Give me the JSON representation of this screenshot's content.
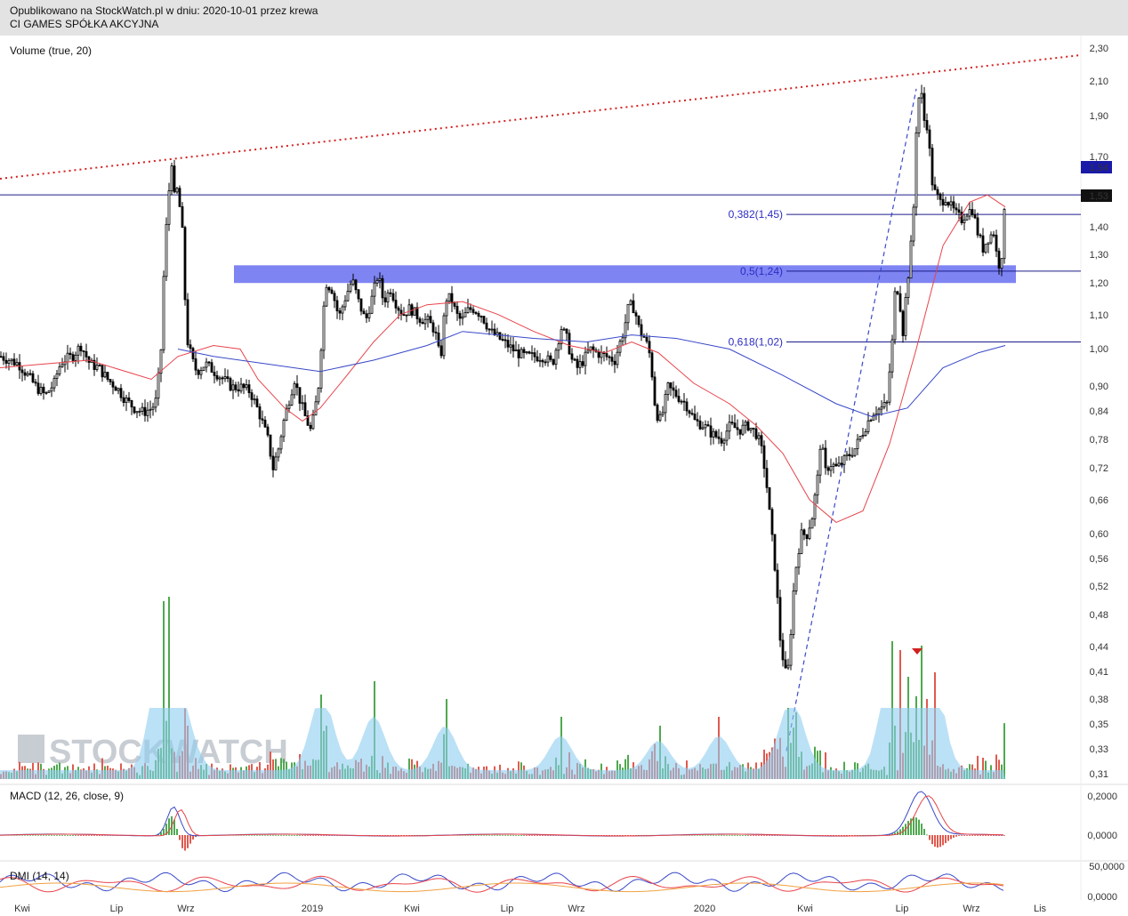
{
  "header": {
    "published": "Opublikowano na StockWatch.pl w dniu: 2020-10-01 przez krewa",
    "instrument": "CI GAMES SPÓŁKA AKCYJNA"
  },
  "watermark": "STOCKWATCH",
  "colors": {
    "price_bar": "#000000",
    "sma_short": "#e8434a",
    "sma_long": "#3848c8",
    "trend_dotted": "#d42020",
    "fib_line": "#1c1c8a",
    "fib_text": "#2c2cc4",
    "zone": "#7e84f2",
    "vol_up": "#4fa84f",
    "vol_down": "#e05a4f",
    "vol_area": "#8ecdf0",
    "macd": "#3848c8",
    "signal": "#e8434a",
    "dmi_plus": "#3848c8",
    "dmi_minus": "#e8434a",
    "adx": "#f0a040"
  },
  "chart_data": [
    {
      "type": "candlestick",
      "title": "CI GAMES SPÓŁKA AKCYJNA",
      "x_tick_labels": [
        "Kwi",
        "Lip",
        "Wrz",
        "2019",
        "Kwi",
        "Lip",
        "Wrz",
        "2020",
        "Kwi",
        "Lip",
        "Wrz",
        "Lis"
      ],
      "y_tick_labels": [
        "2,30",
        "2,10",
        "1,90",
        "1,70",
        "1,40",
        "1,30",
        "1,20",
        "1,10",
        "1,00",
        "0,90",
        "0,84",
        "0,78",
        "0,72",
        "0,66",
        "0,60",
        "0,56",
        "0,52",
        "0,48",
        "0,44",
        "0,41",
        "0,38",
        "0,35",
        "0,33",
        "0,31"
      ],
      "y_scale": "log",
      "ylim": [
        0.31,
        2.3
      ],
      "price_markers": [
        {
          "label": "1,54",
          "value": 1.54,
          "color": "#1a1aa8"
        },
        {
          "label": "1,53",
          "value": 1.53,
          "color": "#111111"
        }
      ],
      "horizontal_lines": [
        {
          "value": 1.53,
          "label": ""
        },
        {
          "value": 1.45,
          "label": "0,382(1,45)"
        },
        {
          "value": 1.24,
          "label": "0,5(1,24)"
        },
        {
          "value": 1.02,
          "label": "0,618(1,02)"
        }
      ],
      "resistance_zone": [
        1.2,
        1.26
      ],
      "series": [
        {
          "name": "",
          "kind": "close",
          "points": [
            [
              0,
              0.98
            ],
            [
              10,
              0.97
            ],
            [
              20,
              0.96
            ],
            [
              30,
              0.93
            ],
            [
              40,
              0.9
            ],
            [
              50,
              0.88
            ],
            [
              60,
              0.91
            ],
            [
              65,
              0.95
            ],
            [
              70,
              0.97
            ],
            [
              80,
              0.98
            ],
            [
              90,
              1.01
            ],
            [
              100,
              0.96
            ],
            [
              110,
              0.95
            ],
            [
              120,
              0.92
            ],
            [
              130,
              0.9
            ],
            [
              140,
              0.87
            ],
            [
              150,
              0.85
            ],
            [
              160,
              0.84
            ],
            [
              170,
              0.85
            ],
            [
              175,
              0.87
            ],
            [
              180,
              1.0
            ],
            [
              183,
              1.22
            ],
            [
              186,
              1.4
            ],
            [
              189,
              1.55
            ],
            [
              192,
              1.68
            ],
            [
              195,
              1.52
            ],
            [
              198,
              1.55
            ],
            [
              201,
              1.48
            ],
            [
              204,
              1.38
            ],
            [
              207,
              1.15
            ],
            [
              210,
              1.02
            ],
            [
              215,
              0.97
            ],
            [
              220,
              0.94
            ],
            [
              230,
              0.96
            ],
            [
              240,
              0.94
            ],
            [
              250,
              0.92
            ],
            [
              260,
              0.9
            ],
            [
              270,
              0.9
            ],
            [
              280,
              0.89
            ],
            [
              290,
              0.84
            ],
            [
              300,
              0.78
            ],
            [
              306,
              0.72
            ],
            [
              312,
              0.76
            ],
            [
              318,
              0.82
            ],
            [
              324,
              0.87
            ],
            [
              330,
              0.92
            ],
            [
              336,
              0.87
            ],
            [
              342,
              0.83
            ],
            [
              348,
              0.8
            ],
            [
              352,
              0.83
            ],
            [
              358,
              0.92
            ],
            [
              362,
              1.1
            ],
            [
              366,
              1.2
            ],
            [
              372,
              1.18
            ],
            [
              380,
              1.09
            ],
            [
              388,
              1.16
            ],
            [
              395,
              1.21
            ],
            [
              402,
              1.14
            ],
            [
              410,
              1.08
            ],
            [
              418,
              1.16
            ],
            [
              424,
              1.23
            ],
            [
              430,
              1.14
            ],
            [
              438,
              1.18
            ],
            [
              445,
              1.13
            ],
            [
              452,
              1.1
            ],
            [
              460,
              1.12
            ],
            [
              470,
              1.09
            ],
            [
              480,
              1.08
            ],
            [
              486,
              1.06
            ],
            [
              490,
              1.03
            ],
            [
              494,
              0.96
            ],
            [
              500,
              1.15
            ],
            [
              506,
              1.15
            ],
            [
              512,
              1.1
            ],
            [
              518,
              1.08
            ],
            [
              524,
              1.11
            ],
            [
              530,
              1.12
            ],
            [
              540,
              1.1
            ],
            [
              550,
              1.05
            ],
            [
              560,
              1.03
            ],
            [
              570,
              1.01
            ],
            [
              580,
              0.99
            ],
            [
              590,
              0.98
            ],
            [
              600,
              0.98
            ],
            [
              610,
              0.98
            ],
            [
              620,
              0.96
            ],
            [
              630,
              1.06
            ],
            [
              636,
              1.03
            ],
            [
              642,
              0.97
            ],
            [
              648,
              0.95
            ],
            [
              655,
              0.97
            ],
            [
              662,
              1.0
            ],
            [
              670,
              0.99
            ],
            [
              680,
              0.98
            ],
            [
              690,
              0.97
            ],
            [
              700,
              1.05
            ],
            [
              706,
              1.13
            ],
            [
              712,
              1.12
            ],
            [
              718,
              1.05
            ],
            [
              724,
              1.03
            ],
            [
              730,
              0.98
            ],
            [
              736,
              0.84
            ],
            [
              742,
              0.82
            ],
            [
              750,
              0.9
            ],
            [
              760,
              0.88
            ],
            [
              770,
              0.86
            ],
            [
              780,
              0.82
            ],
            [
              790,
              0.81
            ],
            [
              800,
              0.79
            ],
            [
              810,
              0.78
            ],
            [
              820,
              0.81
            ],
            [
              830,
              0.8
            ],
            [
              840,
              0.81
            ],
            [
              850,
              0.79
            ],
            [
              856,
              0.75
            ],
            [
              860,
              0.7
            ],
            [
              865,
              0.62
            ],
            [
              870,
              0.55
            ],
            [
              876,
              0.45
            ],
            [
              880,
              0.42
            ],
            [
              884,
              0.4
            ],
            [
              888,
              0.46
            ],
            [
              892,
              0.53
            ],
            [
              896,
              0.57
            ],
            [
              900,
              0.6
            ],
            [
              906,
              0.6
            ],
            [
              912,
              0.63
            ],
            [
              918,
              0.7
            ],
            [
              922,
              0.79
            ],
            [
              926,
              0.71
            ],
            [
              932,
              0.73
            ],
            [
              940,
              0.72
            ],
            [
              950,
              0.74
            ],
            [
              960,
              0.76
            ],
            [
              970,
              0.8
            ],
            [
              980,
              0.84
            ],
            [
              990,
              0.85
            ],
            [
              996,
              0.86
            ],
            [
              1002,
              1.02
            ],
            [
              1006,
              1.21
            ],
            [
              1010,
              1.15
            ],
            [
              1014,
              1.05
            ],
            [
              1018,
              1.18
            ],
            [
              1022,
              1.28
            ],
            [
              1026,
              1.48
            ],
            [
              1030,
              1.95
            ],
            [
              1034,
              2.05
            ],
            [
              1038,
              1.88
            ],
            [
              1042,
              1.85
            ],
            [
              1046,
              1.6
            ],
            [
              1050,
              1.54
            ],
            [
              1056,
              1.5
            ],
            [
              1062,
              1.52
            ],
            [
              1068,
              1.48
            ],
            [
              1074,
              1.45
            ],
            [
              1080,
              1.43
            ],
            [
              1086,
              1.46
            ],
            [
              1092,
              1.47
            ],
            [
              1098,
              1.38
            ],
            [
              1104,
              1.32
            ],
            [
              1110,
              1.36
            ],
            [
              1116,
              1.38
            ],
            [
              1120,
              1.28
            ],
            [
              1124,
              1.25
            ],
            [
              1128,
              1.45
            ],
            [
              1130,
              1.53
            ]
          ]
        },
        {
          "name": "",
          "kind": "sma-short",
          "points": [
            [
              0,
              0.95
            ],
            [
              100,
              0.97
            ],
            [
              170,
              0.92
            ],
            [
              200,
              0.98
            ],
            [
              240,
              1.01
            ],
            [
              270,
              1.0
            ],
            [
              290,
              0.92
            ],
            [
              320,
              0.85
            ],
            [
              340,
              0.82
            ],
            [
              360,
              0.85
            ],
            [
              390,
              0.93
            ],
            [
              420,
              1.02
            ],
            [
              450,
              1.1
            ],
            [
              480,
              1.13
            ],
            [
              520,
              1.14
            ],
            [
              560,
              1.1
            ],
            [
              600,
              1.05
            ],
            [
              640,
              1.01
            ],
            [
              680,
              0.99
            ],
            [
              710,
              1.02
            ],
            [
              740,
              0.99
            ],
            [
              780,
              0.91
            ],
            [
              820,
              0.86
            ],
            [
              850,
              0.81
            ],
            [
              880,
              0.75
            ],
            [
              910,
              0.66
            ],
            [
              940,
              0.62
            ],
            [
              970,
              0.64
            ],
            [
              1000,
              0.77
            ],
            [
              1030,
              1.0
            ],
            [
              1060,
              1.33
            ],
            [
              1090,
              1.5
            ],
            [
              1110,
              1.53
            ],
            [
              1130,
              1.48
            ]
          ]
        },
        {
          "name": "",
          "kind": "sma-long",
          "points": [
            [
              200,
              1.0
            ],
            [
              240,
              0.98
            ],
            [
              300,
              0.96
            ],
            [
              360,
              0.94
            ],
            [
              420,
              0.97
            ],
            [
              480,
              1.01
            ],
            [
              520,
              1.05
            ],
            [
              560,
              1.04
            ],
            [
              600,
              1.03
            ],
            [
              660,
              1.02
            ],
            [
              710,
              1.04
            ],
            [
              760,
              1.03
            ],
            [
              820,
              1.0
            ],
            [
              880,
              0.93
            ],
            [
              940,
              0.86
            ],
            [
              980,
              0.83
            ],
            [
              1020,
              0.85
            ],
            [
              1060,
              0.95
            ],
            [
              1100,
              0.99
            ],
            [
              1130,
              1.01
            ]
          ]
        }
      ],
      "trend_line_dotted": [
        [
          0,
          1.6
        ],
        [
          1215,
          2.25
        ]
      ],
      "trend_line_dashed": [
        [
          884,
          0.33
        ],
        [
          1030,
          2.05
        ]
      ]
    },
    {
      "type": "bar",
      "title": "Volume (true, 20)",
      "note": "volume histogram with 20-period average area"
    },
    {
      "type": "line",
      "title": "MACD (12, 26, close, 9)",
      "y_tick_labels": [
        "0,2000",
        "0,0000"
      ],
      "series": [
        {
          "name": "",
          "kind": "macd"
        },
        {
          "name": "",
          "kind": "signal"
        }
      ]
    },
    {
      "type": "line",
      "title": "DMI (14, 14)",
      "y_tick_labels": [
        "50,0000",
        "0,0000"
      ],
      "series": [
        {
          "name": "",
          "kind": "di-plus"
        },
        {
          "name": "",
          "kind": "di-minus"
        },
        {
          "name": "",
          "kind": "adx"
        }
      ]
    }
  ]
}
